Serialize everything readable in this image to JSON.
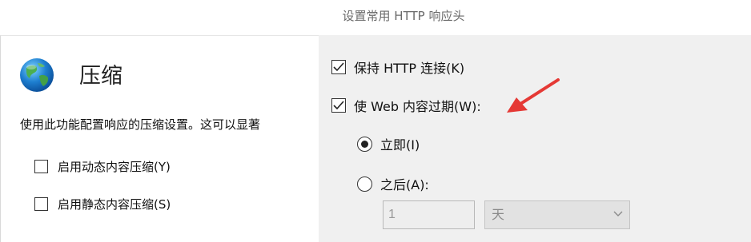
{
  "dialog": {
    "title": "设置常用 HTTP 响应头"
  },
  "compression": {
    "heading": "压缩",
    "description": "使用此功能配置响应的压缩设置。这可以显著",
    "options": [
      {
        "label": "启用动态内容压缩(Y)",
        "checked": false
      },
      {
        "label": "启用静态内容压缩(S)",
        "checked": false
      }
    ],
    "icon": "globe-icon"
  },
  "headers": {
    "keep_alive": {
      "label": "保持 HTTP 连接(K)",
      "checked": true
    },
    "expire": {
      "label": "使 Web 内容过期(W):",
      "checked": true
    },
    "immediately": {
      "label": "立即(I)",
      "selected": true
    },
    "after": {
      "label": "之后(A):",
      "selected": false
    },
    "after_value": "1",
    "after_unit": "天"
  },
  "annotation": {
    "color": "#e53935",
    "icon": "red-arrow-icon"
  }
}
